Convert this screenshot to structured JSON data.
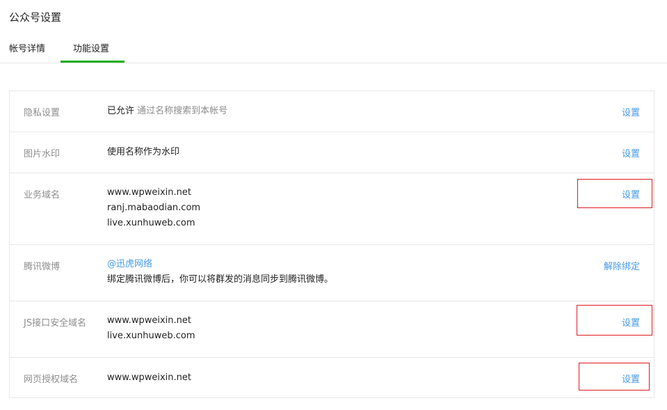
{
  "page": {
    "title": "公众号设置"
  },
  "tabs": [
    {
      "label": "帐号详情"
    },
    {
      "label": "功能设置"
    }
  ],
  "settings": {
    "privacy": {
      "label": "隐私设置",
      "status": "已允许",
      "note": "通过名称搜索到本帐号",
      "action": "设置"
    },
    "watermark": {
      "label": "图片水印",
      "value": "使用名称作为水印",
      "action": "设置"
    },
    "business_domain": {
      "label": "业务域名",
      "domains": [
        "www.wpweixin.net",
        "ranj.mabaodian.com",
        "live.xunhuweb.com"
      ],
      "action": "设置"
    },
    "tencent_weibo": {
      "label": "腾讯微博",
      "account": "@迅虎网络",
      "note": "绑定腾讯微博后，你可以将群发的消息同步到腾讯微博。",
      "action": "解除绑定"
    },
    "js_domain": {
      "label": "JS接口安全域名",
      "domains": [
        "www.wpweixin.net",
        "live.xunhuweb.com"
      ],
      "action": "设置"
    },
    "oauth_domain": {
      "label": "网页授权域名",
      "domains": [
        "www.wpweixin.net"
      ],
      "action": "设置"
    }
  },
  "colors": {
    "accent": "#1aad19",
    "link": "#459ae9",
    "highlight": "#e0181c"
  }
}
